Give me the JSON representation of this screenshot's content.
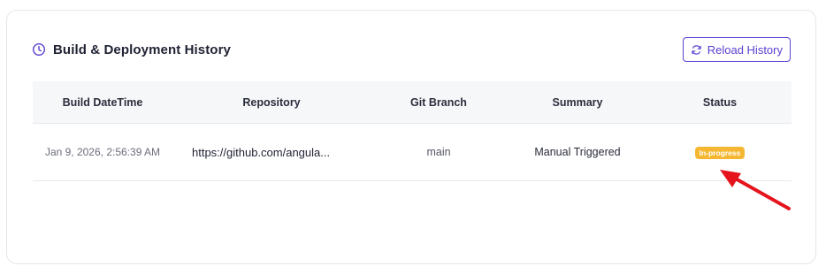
{
  "header": {
    "title": "Build & Deployment History",
    "reload_label": "Reload History"
  },
  "table": {
    "columns": [
      "Build DateTime",
      "Repository",
      "Git Branch",
      "Summary",
      "Status"
    ],
    "rows": [
      {
        "build_datetime": "Jan 9, 2026, 2:56:39 AM",
        "repository": "https://github.com/angula...",
        "git_branch": "main",
        "summary": "Manual Triggered",
        "status": "In-progress"
      }
    ]
  },
  "colors": {
    "accent": "#5b3fd1",
    "status_in_progress": "#f5b731",
    "annotation_arrow": "#e5141c"
  },
  "icons": {
    "title_icon": "clock-icon",
    "reload_icon": "refresh-icon",
    "annotation": "red-arrow-icon"
  }
}
